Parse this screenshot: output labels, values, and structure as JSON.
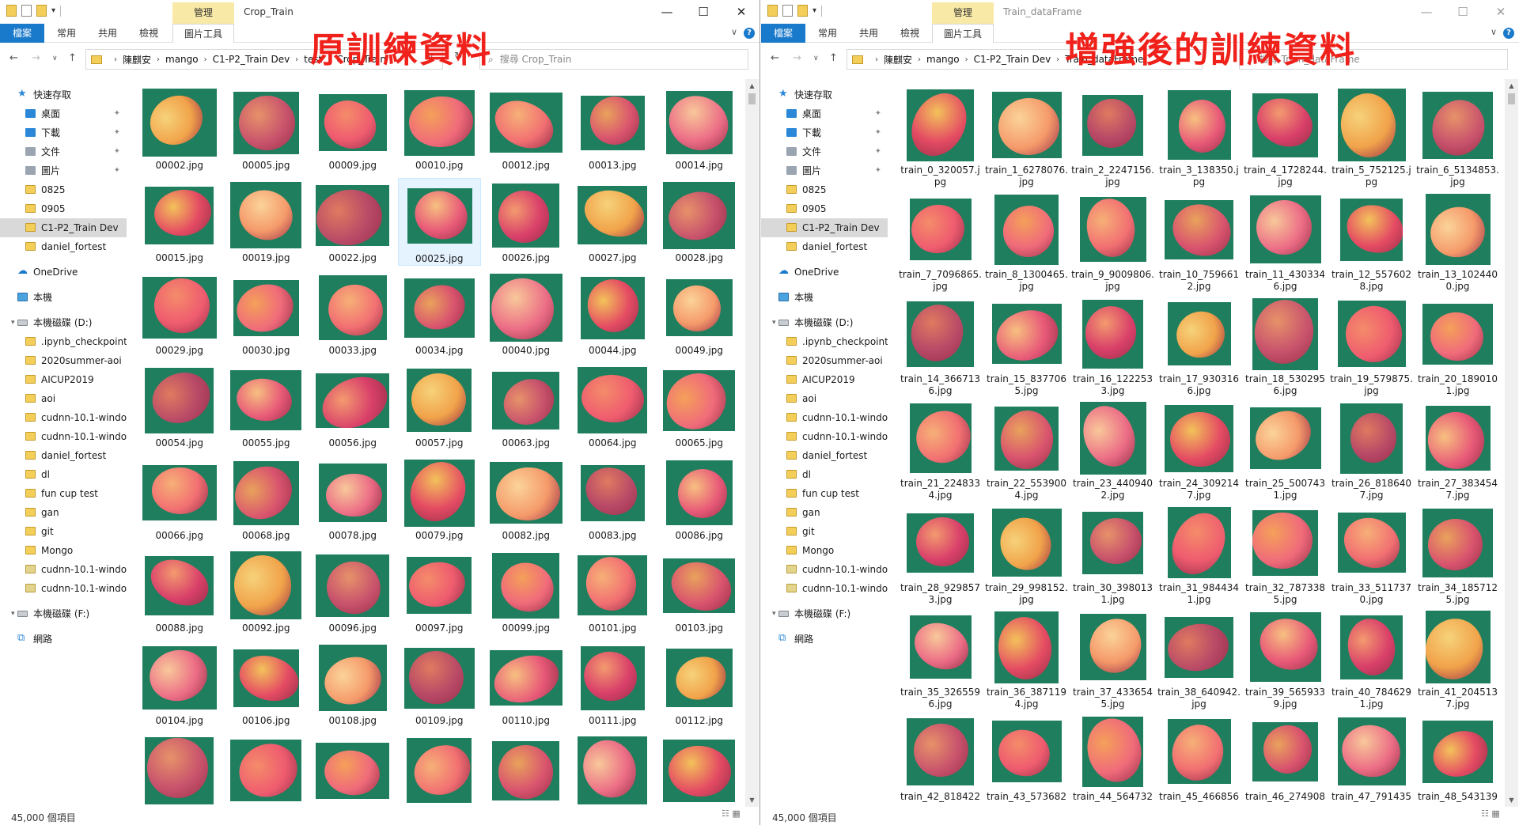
{
  "annotations": {
    "left_title": "原訓練資料",
    "right_title": "增強後的訓練資料"
  },
  "left": {
    "window_title": "Crop_Train",
    "ribbon": {
      "manage": "管理",
      "file": "檔案",
      "home": "常用",
      "share": "共用",
      "view": "檢視",
      "picture_tools": "圖片工具"
    },
    "breadcrumb": [
      "陳麒安",
      "mango",
      "C1-P2_Train Dev",
      "test",
      "Crop_Train"
    ],
    "search_placeholder": "搜尋 Crop_Train",
    "status": "45,000 個項目",
    "files": [
      "00002.jpg",
      "00005.jpg",
      "00009.jpg",
      "00010.jpg",
      "00012.jpg",
      "00013.jpg",
      "00014.jpg",
      "00015.jpg",
      "00019.jpg",
      "00022.jpg",
      "00025.jpg",
      "00026.jpg",
      "00027.jpg",
      "00028.jpg",
      "00029.jpg",
      "00030.jpg",
      "00033.jpg",
      "00034.jpg",
      "00040.jpg",
      "00044.jpg",
      "00049.jpg",
      "00054.jpg",
      "00055.jpg",
      "00056.jpg",
      "00057.jpg",
      "00063.jpg",
      "00064.jpg",
      "00065.jpg",
      "00066.jpg",
      "00068.jpg",
      "00078.jpg",
      "00079.jpg",
      "00082.jpg",
      "00083.jpg",
      "00086.jpg",
      "00088.jpg",
      "00092.jpg",
      "00096.jpg",
      "00097.jpg",
      "00099.jpg",
      "00101.jpg",
      "00103.jpg",
      "00104.jpg",
      "00106.jpg",
      "00108.jpg",
      "00109.jpg",
      "00110.jpg",
      "00111.jpg",
      "00112.jpg",
      "",
      "",
      "",
      "",
      "",
      "",
      ""
    ],
    "selected_index": 10
  },
  "right": {
    "window_title": "Train_dataFrame",
    "ribbon": {
      "manage": "管理",
      "file": "檔案",
      "home": "常用",
      "share": "共用",
      "view": "檢視",
      "picture_tools": "圖片工具"
    },
    "breadcrumb": [
      "陳麒安",
      "mango",
      "C1-P2_Train Dev",
      "Train_dataFrame"
    ],
    "search_placeholder": "搜尋 Train_dataFrame",
    "status": "45,000 個項目",
    "files": [
      "train_0_320057.jpg",
      "train_1_6278076.jpg",
      "train_2_2247156.jpg",
      "train_3_138350.jpg",
      "train_4_1728244.jpg",
      "train_5_752125.jpg",
      "train_6_5134853.jpg",
      "train_7_7096865.jpg",
      "train_8_1300465.jpg",
      "train_9_9009806.jpg",
      "train_10_7596612.jpg",
      "train_11_4303346.jpg",
      "train_12_5576028.jpg",
      "train_13_1024400.jpg",
      "train_14_3667136.jpg",
      "train_15_8377065.jpg",
      "train_16_1222533.jpg",
      "train_17_9303166.jpg",
      "train_18_5302956.jpg",
      "train_19_579875.jpg",
      "train_20_1890101.jpg",
      "train_21_2248334.jpg",
      "train_22_5539004.jpg",
      "train_23_4409402.jpg",
      "train_24_3092147.jpg",
      "train_25_5007431.jpg",
      "train_26_8186407.jpg",
      "train_27_3834547.jpg",
      "train_28_9298573.jpg",
      "train_29_998152.jpg",
      "train_30_3980131.jpg",
      "train_31_9844341.jpg",
      "train_32_7873385.jpg",
      "train_33_5117370.jpg",
      "train_34_1857125.jpg",
      "train_35_3265596.jpg",
      "train_36_3871194.jpg",
      "train_37_4336545.jpg",
      "train_38_640942.jpg",
      "train_39_5659339.jpg",
      "train_40_7846291.jpg",
      "train_41_2045137.jpg",
      "train_42_818422",
      "train_43_573682",
      "train_44_564732",
      "train_45_466856",
      "train_46_274908",
      "train_47_791435",
      "train_48_543139"
    ]
  },
  "sidebar": {
    "items": [
      {
        "label": "快速存取",
        "icon": "star-icon",
        "pin": false,
        "indent": 1
      },
      {
        "label": "桌面",
        "icon": "desktop-icon",
        "pin": true,
        "indent": 2
      },
      {
        "label": "下載",
        "icon": "download-icon",
        "pin": true,
        "indent": 2
      },
      {
        "label": "文件",
        "icon": "document-icon",
        "pin": true,
        "indent": 2
      },
      {
        "label": "圖片",
        "icon": "pictures-icon",
        "pin": true,
        "indent": 2
      },
      {
        "label": "0825",
        "icon": "folder-icon",
        "pin": false,
        "indent": 2
      },
      {
        "label": "0905",
        "icon": "folder-icon",
        "pin": false,
        "indent": 2
      },
      {
        "label": "C1-P2_Train Dev",
        "icon": "folder-icon",
        "pin": false,
        "indent": 2,
        "selected": true
      },
      {
        "label": "daniel_fortest",
        "icon": "folder-icon",
        "pin": false,
        "indent": 2
      },
      {
        "label": "",
        "icon": "",
        "spacer": true
      },
      {
        "label": "OneDrive",
        "icon": "onedrive-icon",
        "pin": false,
        "indent": 1
      },
      {
        "label": "",
        "icon": "",
        "spacer": true
      },
      {
        "label": "本機",
        "icon": "computer-icon",
        "pin": false,
        "indent": 1
      },
      {
        "label": "",
        "icon": "",
        "spacer": true
      },
      {
        "label": "本機磁碟 (D:)",
        "icon": "drive-icon",
        "pin": false,
        "indent": 1,
        "expanded": true
      },
      {
        "label": ".ipynb_checkpoint",
        "icon": "folder-icon",
        "pin": false,
        "indent": 2
      },
      {
        "label": "2020summer-aoi",
        "icon": "folder-icon",
        "pin": false,
        "indent": 2
      },
      {
        "label": "AICUP2019",
        "icon": "folder-icon",
        "pin": false,
        "indent": 2
      },
      {
        "label": "aoi",
        "icon": "folder-icon",
        "pin": false,
        "indent": 2
      },
      {
        "label": "cudnn-10.1-windo",
        "icon": "folder-icon",
        "pin": false,
        "indent": 2
      },
      {
        "label": "cudnn-10.1-windo",
        "icon": "folder-icon",
        "pin": false,
        "indent": 2
      },
      {
        "label": "daniel_fortest",
        "icon": "folder-icon",
        "pin": false,
        "indent": 2
      },
      {
        "label": "dl",
        "icon": "folder-icon",
        "pin": false,
        "indent": 2
      },
      {
        "label": "fun cup test",
        "icon": "folder-icon",
        "pin": false,
        "indent": 2
      },
      {
        "label": "gan",
        "icon": "folder-icon",
        "pin": false,
        "indent": 2
      },
      {
        "label": "git",
        "icon": "folder-icon",
        "pin": false,
        "indent": 2
      },
      {
        "label": "Mongo",
        "icon": "folder-icon",
        "pin": false,
        "indent": 2
      },
      {
        "label": "cudnn-10.1-windo",
        "icon": "zip-icon",
        "pin": false,
        "indent": 2
      },
      {
        "label": "cudnn-10.1-windo",
        "icon": "zip-icon",
        "pin": false,
        "indent": 2
      },
      {
        "label": "",
        "icon": "",
        "spacer": true
      },
      {
        "label": "本機磁碟 (F:)",
        "icon": "drive-icon",
        "pin": false,
        "indent": 1,
        "expanded": true
      },
      {
        "label": "",
        "icon": "",
        "spacer": true
      },
      {
        "label": "網路",
        "icon": "network-icon",
        "pin": false,
        "indent": 1
      }
    ]
  },
  "colors": {
    "file_tab": "#1979ca",
    "manage_tab": "#f9e9a6",
    "annotation": "#f0201a",
    "thumb_bg": "#1f7e5d",
    "selected_tile": "#e5f3ff"
  }
}
